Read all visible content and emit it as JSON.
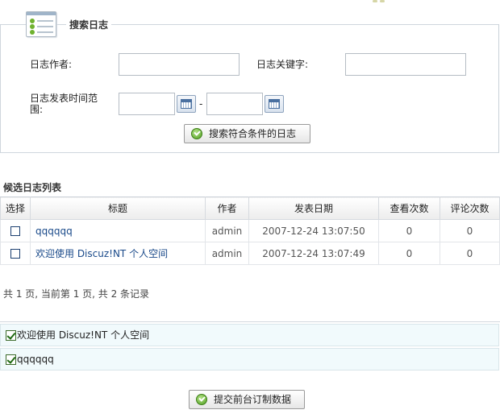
{
  "search": {
    "legend": "搜索日志",
    "author_label": "日志作者:",
    "author_value": "",
    "keyword_label": "日志关键字:",
    "keyword_value": "",
    "date_label": "日志发表时间范围:",
    "date_from": "",
    "date_separator": "-",
    "date_to": "",
    "submit_label": "搜索符合条件的日志"
  },
  "list": {
    "title": "候选日志列表",
    "columns": [
      "选择",
      "标题",
      "作者",
      "发表日期",
      "查看次数",
      "评论次数"
    ],
    "rows": [
      {
        "title": "qqqqqq",
        "author": "admin",
        "date": "2007-12-24 13:07:50",
        "views": "0",
        "comments": "0"
      },
      {
        "title": "欢迎使用 Discuz!NT 个人空间",
        "author": "admin",
        "date": "2007-12-24 13:07:49",
        "views": "0",
        "comments": "0"
      }
    ],
    "pager": "共 1 页, 当前第 1 页, 共 2 条记录"
  },
  "selected": {
    "items": [
      "欢迎使用 Discuz!NT 个人空间",
      "qqqqqq"
    ]
  },
  "footer": {
    "submit_label": "提交前台订制数据"
  },
  "icons": {
    "legend": "list-panel-icon",
    "calendar": "calendar-icon",
    "ok": "check-circle-icon"
  }
}
